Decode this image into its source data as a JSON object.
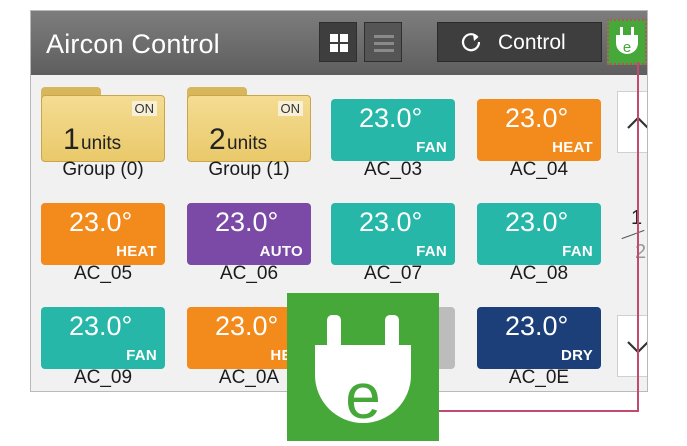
{
  "header": {
    "title": "Aircon Control",
    "control_label": "Control"
  },
  "groups": [
    {
      "on_label": "ON",
      "count": "1",
      "units_label": "units",
      "name": "Group (0)"
    },
    {
      "on_label": "ON",
      "count": "2",
      "units_label": "units",
      "name": "Group (1)"
    }
  ],
  "units": [
    {
      "name": "AC_03",
      "temp": "23.0°",
      "mode": "FAN",
      "color": "#26b7a8"
    },
    {
      "name": "AC_04",
      "temp": "23.0°",
      "mode": "HEAT",
      "color": "#f28a1c"
    },
    {
      "name": "AC_05",
      "temp": "23.0°",
      "mode": "HEAT",
      "color": "#f28a1c"
    },
    {
      "name": "AC_06",
      "temp": "23.0°",
      "mode": "AUTO",
      "color": "#7b4aa6"
    },
    {
      "name": "AC_07",
      "temp": "23.0°",
      "mode": "FAN",
      "color": "#26b7a8"
    },
    {
      "name": "AC_08",
      "temp": "23.0°",
      "mode": "FAN",
      "color": "#26b7a8"
    },
    {
      "name": "AC_09",
      "temp": "23.0°",
      "mode": "FAN",
      "color": "#26b7a8"
    },
    {
      "name": "AC_0A",
      "temp": "23.0°",
      "mode": "HEA",
      "color": "#f28a1c"
    },
    {
      "name": "AC_0E",
      "temp": "23.0°",
      "mode": "DRY",
      "color": "#1c3f7a"
    }
  ],
  "pagination": {
    "current": "1",
    "total": "2"
  },
  "icons": {
    "grid_view": "grid-icon",
    "list_view": "list-icon",
    "control": "refresh-circle-icon",
    "plug": "plug-e-icon",
    "scroll_up": "chevron-up-icon",
    "scroll_down": "chevron-down-icon"
  },
  "colors": {
    "plug_green": "#47a83a",
    "callout_line": "#c24a6e"
  }
}
